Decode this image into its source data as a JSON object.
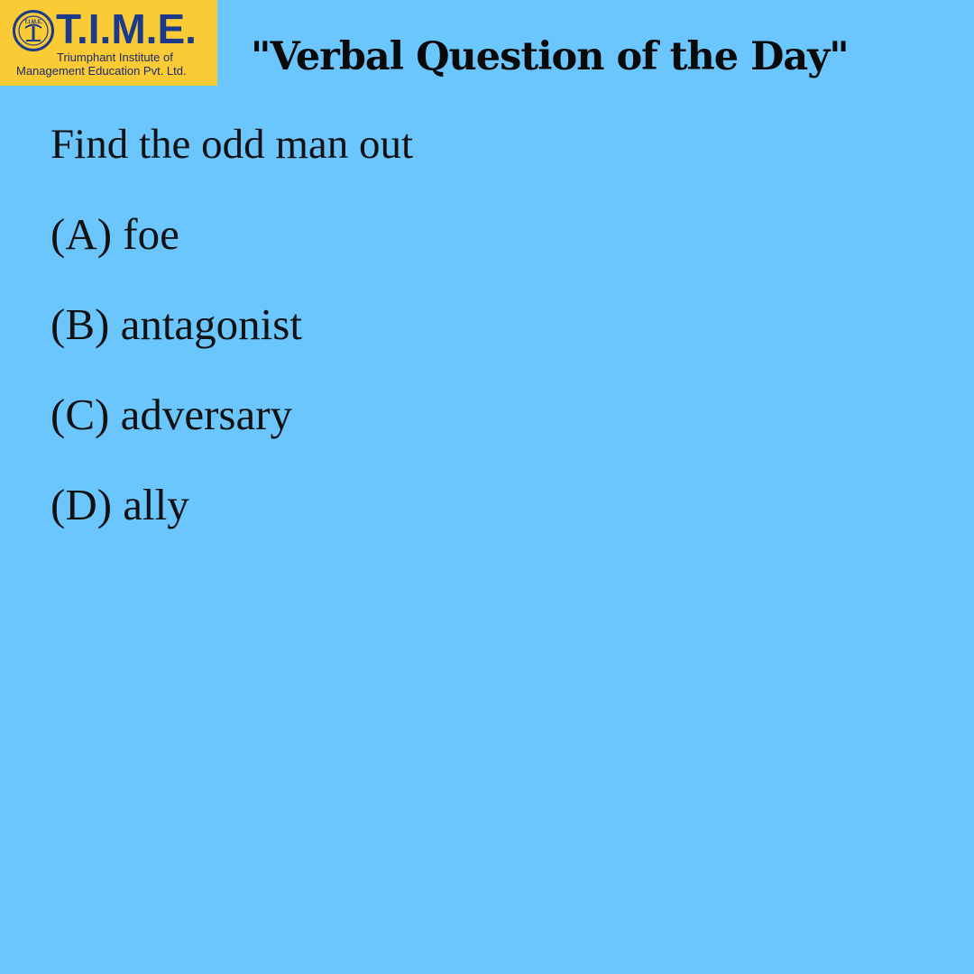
{
  "logo": {
    "emblem_text": "T.I.M.E.",
    "wordmark": "T.I.M.E.",
    "subtitle_line1": "Triumphant Institute of",
    "subtitle_line2": "Management Education Pvt. Ltd.",
    "background": "#fbcb35",
    "color": "#1b3a8a"
  },
  "title": "\"Verbal Question of the Day\"",
  "question": "Find the odd man out",
  "options": [
    "(A) foe",
    "(B) antagonist",
    "(C) adversary",
    "(D) ally"
  ],
  "background_color": "#6cc6fe"
}
